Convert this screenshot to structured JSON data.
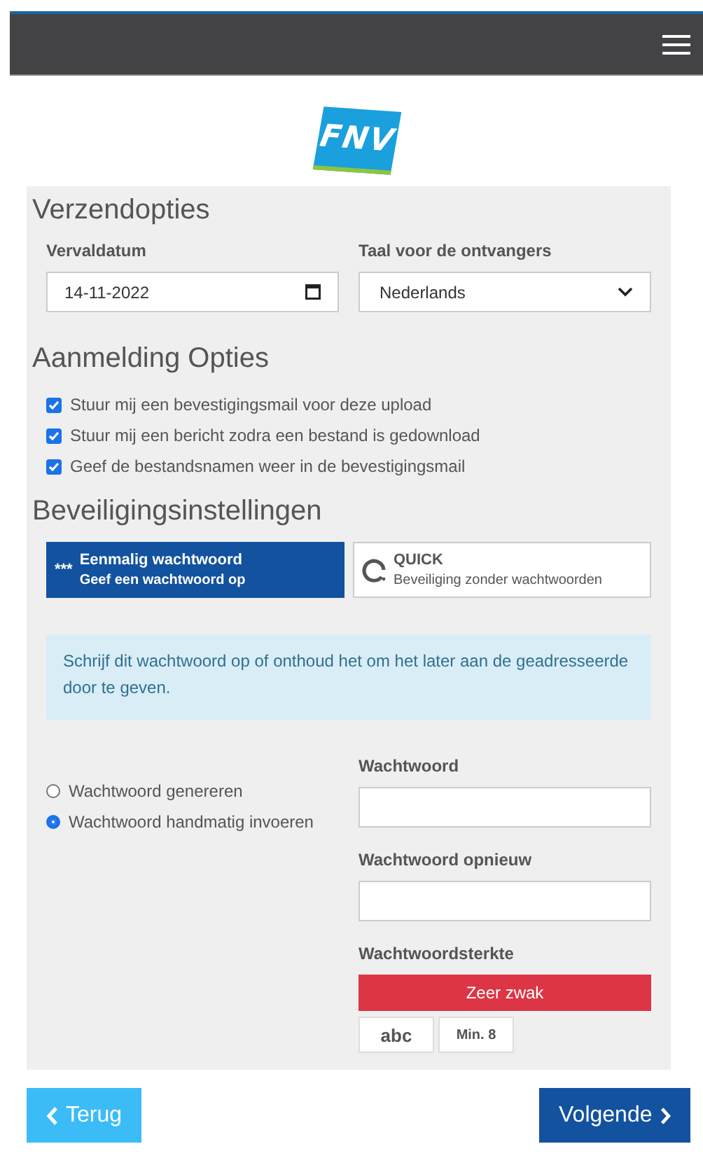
{
  "logo": {
    "text": "FNV"
  },
  "sections": [
    {
      "title": "Verzendopties"
    },
    {
      "title": "Aanmelding Opties"
    },
    {
      "title": "Beveiligingsinstellingen"
    }
  ],
  "expiry": {
    "label": "Vervaldatum",
    "value": "14-11-2022"
  },
  "language": {
    "label": "Taal voor de ontvangers",
    "value": "Nederlands"
  },
  "notifications": [
    {
      "label": "Stuur mij een bevestigingsmail voor deze upload",
      "checked": true
    },
    {
      "label": "Stuur mij een bericht zodra een bestand is gedownload",
      "checked": true
    },
    {
      "label": "Geef de bestandsnamen weer in de bevestigingsmail",
      "checked": true
    }
  ],
  "security_options": [
    {
      "kind": "password",
      "icon_text": "***",
      "title": "Eenmalig wachtwoord",
      "subtitle": "Geef een wachtwoord op",
      "selected": true
    },
    {
      "kind": "quick",
      "title": "QUICK",
      "subtitle": "Beveiliging zonder wachtwoorden",
      "selected": false
    }
  ],
  "info": "Schrijf dit wachtwoord op of onthoud het om het later aan de geadresseerde door te geven.",
  "password_modes": [
    {
      "label": "Wachtwoord genereren",
      "selected": false
    },
    {
      "label": "Wachtwoord handmatig invoeren",
      "selected": true
    }
  ],
  "password": {
    "label": "Wachtwoord"
  },
  "password_repeat": {
    "label": "Wachtwoord opnieuw"
  },
  "strength": {
    "label": "Wachtwoordsterkte",
    "reading": "Zeer zwak",
    "hints": [
      "abc",
      "Min. 8"
    ]
  },
  "buttons": {
    "back": "Terug",
    "next": "Volgende"
  }
}
